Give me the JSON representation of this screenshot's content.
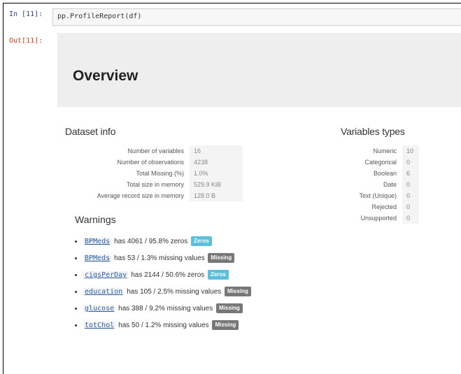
{
  "input_cell": {
    "prompt": "In [11]:",
    "code": "pp.ProfileReport(df)"
  },
  "output_cell": {
    "prompt": "Out[11]:"
  },
  "overview": {
    "title": "Overview"
  },
  "dataset_info": {
    "title": "Dataset info",
    "rows": [
      {
        "label": "Number of variables",
        "value": "16"
      },
      {
        "label": "Number of observations",
        "value": "4238"
      },
      {
        "label": "Total Missing (%)",
        "value": "1.0%"
      },
      {
        "label": "Total size in memory",
        "value": "529.9 KiB"
      },
      {
        "label": "Average record size in memory",
        "value": "128.0 B"
      }
    ]
  },
  "variables_types": {
    "title": "Variables types",
    "rows": [
      {
        "label": "Numeric",
        "value": "10"
      },
      {
        "label": "Categorical",
        "value": "0"
      },
      {
        "label": "Boolean",
        "value": "6"
      },
      {
        "label": "Date",
        "value": "0"
      },
      {
        "label": "Text (Unique)",
        "value": "0"
      },
      {
        "label": "Rejected",
        "value": "0"
      },
      {
        "label": "Unsupported",
        "value": "0"
      }
    ]
  },
  "warnings": {
    "title": "Warnings",
    "items": [
      {
        "var": "BPMeds",
        "text": "has 4061 / 95.8% zeros",
        "badge": "Zeros"
      },
      {
        "var": "BPMeds",
        "text": "has 53 / 1.3% missing values",
        "badge": "Missing"
      },
      {
        "var": "cigsPerDay",
        "text": "has 2144 / 50.6% zeros",
        "badge": "Zeros"
      },
      {
        "var": "education",
        "text": "has 105 / 2.5% missing values",
        "badge": "Missing"
      },
      {
        "var": "glucose",
        "text": "has 388 / 9.2% missing values",
        "badge": "Missing"
      },
      {
        "var": "totChol",
        "text": "has 50 / 1.2% missing values",
        "badge": "Missing"
      }
    ]
  },
  "colors": {
    "zeros_badge": "#5bc0de",
    "missing_badge": "#777777",
    "overview_bg": "#eeeeee"
  }
}
